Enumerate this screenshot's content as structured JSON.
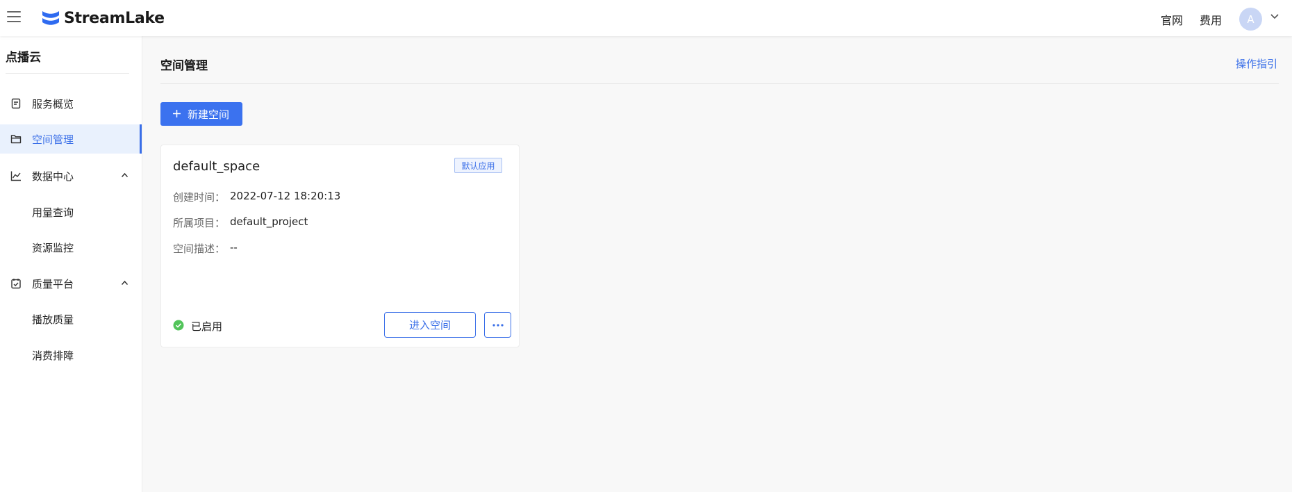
{
  "topbar": {
    "brand": "StreamLake",
    "links": {
      "official": "官网",
      "fee": "费用"
    },
    "avatar_initial": "A"
  },
  "sidebar": {
    "title": "点播云",
    "items": [
      {
        "label": "服务概览",
        "icon": "document-icon"
      },
      {
        "label": "空间管理",
        "icon": "folder-icon",
        "active": true
      },
      {
        "label": "数据中心",
        "icon": "line-chart-icon",
        "expanded": true
      },
      {
        "label": "用量查询"
      },
      {
        "label": "资源监控"
      },
      {
        "label": "质量平台",
        "icon": "checklist-icon",
        "expanded": true
      },
      {
        "label": "播放质量"
      },
      {
        "label": "消费排障"
      }
    ]
  },
  "main": {
    "title": "空间管理",
    "guide_link": "操作指引",
    "new_button": "新建空间",
    "card": {
      "name": "default_space",
      "tag": "默认应用",
      "fields": [
        {
          "label": "创建时间：",
          "value": "2022-07-12 18:20:13"
        },
        {
          "label": "所属项目：",
          "value": "default_project"
        },
        {
          "label": "空间描述：",
          "value": "--"
        }
      ],
      "status": "已启用",
      "enter_button": "进入空间"
    }
  },
  "colors": {
    "accent": "#3a6fe8",
    "primary_button": "#3b72ef",
    "status_green": "#52c45a",
    "active_bg": "#e9f1fd"
  }
}
